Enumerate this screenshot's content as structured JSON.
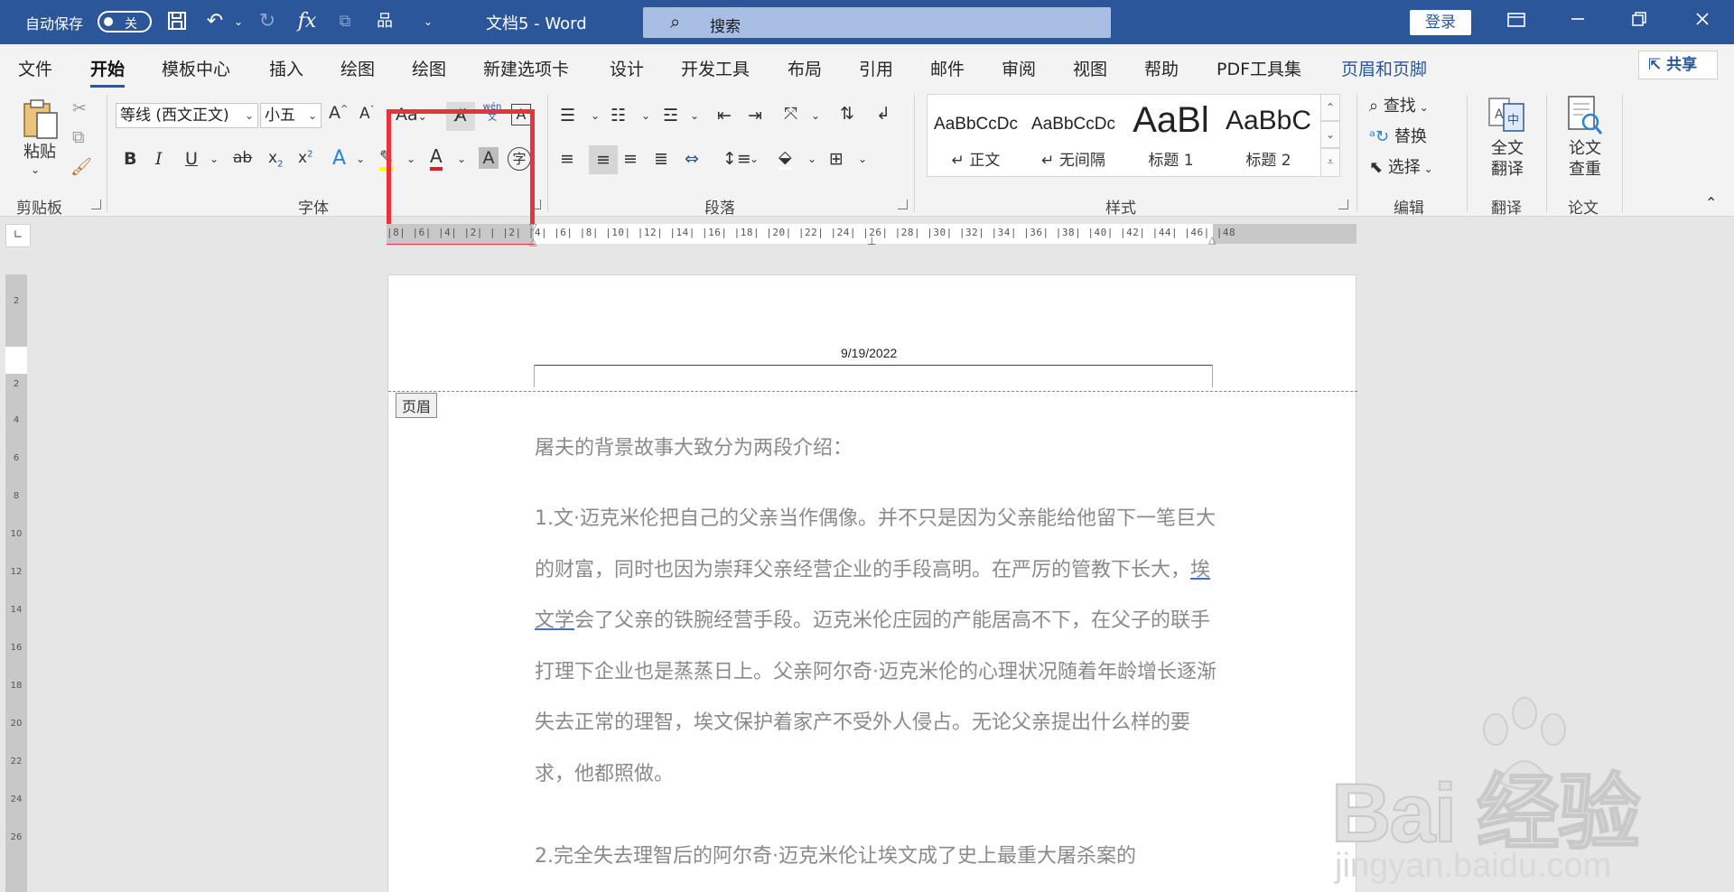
{
  "titlebar": {
    "autosave_label": "自动保存",
    "autosave_state": "关",
    "doc_title": "文档5  -  Word",
    "search_placeholder": "搜索",
    "login_label": "登录",
    "icons": [
      "save-icon",
      "undo-icon",
      "redo-icon",
      "function-icon",
      "shapes-icon",
      "hierarchy-icon"
    ]
  },
  "tabs": [
    {
      "label": "文件"
    },
    {
      "label": "开始",
      "active": true
    },
    {
      "label": "模板中心"
    },
    {
      "label": "插入"
    },
    {
      "label": "绘图"
    },
    {
      "label": "绘图"
    },
    {
      "label": "新建选项卡"
    },
    {
      "label": "设计"
    },
    {
      "label": "开发工具"
    },
    {
      "label": "布局"
    },
    {
      "label": "引用"
    },
    {
      "label": "邮件"
    },
    {
      "label": "审阅"
    },
    {
      "label": "视图"
    },
    {
      "label": "帮助"
    },
    {
      "label": "PDF工具集"
    },
    {
      "label": "页眉和页脚",
      "contextual": true
    }
  ],
  "share_label": "共享",
  "ribbon": {
    "clipboard": {
      "paste_label": "粘贴",
      "group_label": "剪贴板"
    },
    "font": {
      "font_name": "等线 (西文正文)",
      "font_size": "小五",
      "change_case": "Aa",
      "pinyin_top": "wén",
      "pinyin_bottom": "文",
      "group_label": "字体"
    },
    "paragraph": {
      "group_label": "段落"
    },
    "styles": {
      "group_label": "样式",
      "items": [
        {
          "sample": "AaBbCcDc",
          "name": "↵ 正文"
        },
        {
          "sample": "AaBbCcDc",
          "name": "↵ 无间隔"
        },
        {
          "sample": "AaBl",
          "name": "标题 1"
        },
        {
          "sample": "AaBbC",
          "name": "标题 2"
        }
      ]
    },
    "editing": {
      "find": "查找",
      "replace": "替换",
      "select": "选择",
      "group_label": "编辑"
    },
    "translate": {
      "line1": "全文",
      "line2": "翻译",
      "group_label": "翻译"
    },
    "paper": {
      "line1": "论文",
      "line2": "查重",
      "group_label": "论文"
    }
  },
  "ruler": {
    "h_numbers": "|8|  |6|  |4|  |2|  |    |2|  |4|  |6|  |8|  |10|  |12|  |14|  |16|  |18|  |20|  |22|  |24|  |26|  |28|  |30|  |32|  |34|  |36|  |38|  |40|  |42|  |44|  |46|  |48",
    "v_numbers": [
      "2",
      "",
      "2",
      "4",
      "6",
      "8",
      "10",
      "12",
      "14",
      "16",
      "18",
      "20",
      "22",
      "24",
      "26"
    ]
  },
  "document": {
    "header_date": "9/19/2022",
    "header_tag": "页眉",
    "p1": "屠夫的背景故事大致分为两段介绍：",
    "p2_before": "1.文·迈克米伦把自己的父亲当作偶像。并不只是因为父亲能给他留下一笔巨大的财富，同时也因为崇拜父亲经营企业的手段高明。在严厉的管教下长大，",
    "p2_link": "埃文学",
    "p2_after": "会了父亲的铁腕经营手段。迈克米伦庄园的产能居高不下，在父子的联手打理下企业也是蒸蒸日上。父亲阿尔奇·迈克米伦的心理状况随着年龄增长逐渐失去正常的理智，埃文保护着家产不受外人侵占。无论父亲提出什么样的要求，他都照做。",
    "p3": "2.完全失去理智后的阿尔奇·迈克米伦让埃文成了史上最重大屠杀案的"
  },
  "watermark": {
    "big": "Bai  经验",
    "small": "jingyan.baidu.com"
  }
}
